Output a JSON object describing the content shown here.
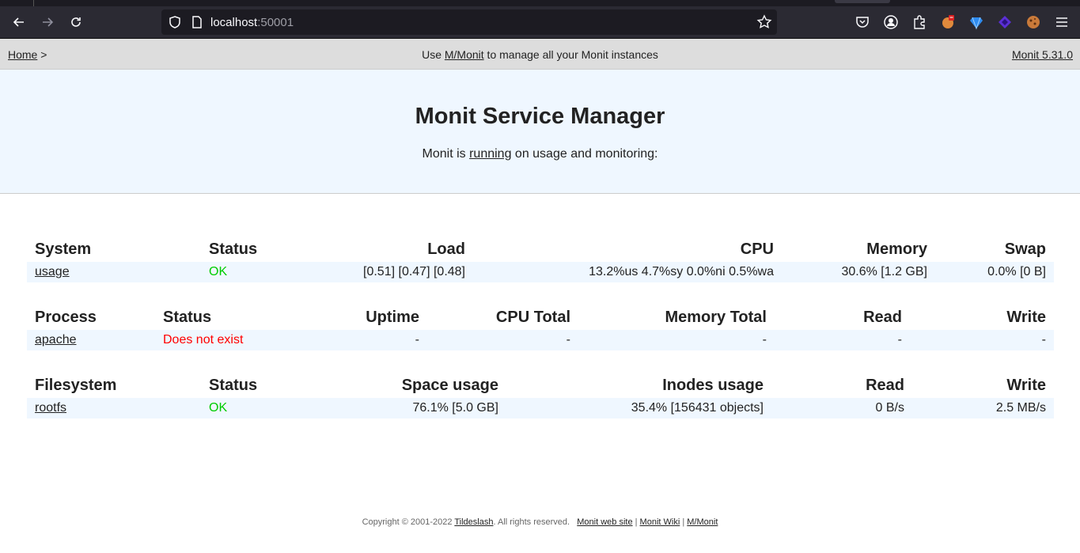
{
  "browser": {
    "url_host": "localhost",
    "url_port": ":50001"
  },
  "header": {
    "home_link": "Home",
    "breadcrumb_sep": ">",
    "center_prefix": "Use ",
    "center_link": "M/Monit",
    "center_suffix": " to manage all your Monit instances",
    "version_link": "Monit 5.31.0"
  },
  "hero": {
    "title": "Monit Service Manager",
    "status_prefix": "Monit is ",
    "status_link": "running",
    "status_suffix": " on usage and monitoring:"
  },
  "system_table": {
    "headers": [
      "System",
      "Status",
      "Load",
      "CPU",
      "Memory",
      "Swap"
    ],
    "rows": [
      {
        "name": "usage",
        "status": "OK",
        "load": "[0.51] [0.47] [0.48]",
        "cpu": "13.2%us 4.7%sy 0.0%ni 0.5%wa",
        "memory": "30.6% [1.2 GB]",
        "swap": "0.0% [0 B]"
      }
    ]
  },
  "process_table": {
    "headers": [
      "Process",
      "Status",
      "Uptime",
      "CPU Total",
      "Memory Total",
      "Read",
      "Write"
    ],
    "rows": [
      {
        "name": "apache",
        "status": "Does not exist",
        "uptime": "-",
        "cpu_total": "-",
        "memory_total": "-",
        "read": "-",
        "write": "-"
      }
    ]
  },
  "filesystem_table": {
    "headers": [
      "Filesystem",
      "Status",
      "Space usage",
      "Inodes usage",
      "Read",
      "Write"
    ],
    "rows": [
      {
        "name": "rootfs",
        "status": "OK",
        "space": "76.1% [5.0 GB]",
        "inodes": "35.4% [156431 objects]",
        "read": "0 B/s",
        "write": "2.5 MB/s"
      }
    ]
  },
  "footer": {
    "copyright": "Copyright © 2001-2022 ",
    "company_link": "Tildeslash",
    "rights": ". All rights reserved.",
    "site_link": "Monit web site",
    "sep1": " | ",
    "wiki_link": "Monit Wiki",
    "sep2": " | ",
    "mmonit_link": "M/Monit"
  },
  "colors": {
    "ok": "#00cc00",
    "error": "#ff0000",
    "row_bg": "#eff7ff",
    "header_bg": "#dddddd"
  },
  "icons": {
    "back": "back-arrow-icon",
    "forward": "forward-arrow-icon",
    "reload": "reload-icon",
    "shield": "shield-icon",
    "page": "page-icon",
    "star": "bookmark-star-icon",
    "pocket": "pocket-icon",
    "account": "account-icon",
    "extensions": "extensions-icon",
    "menu": "hamburger-menu-icon"
  }
}
